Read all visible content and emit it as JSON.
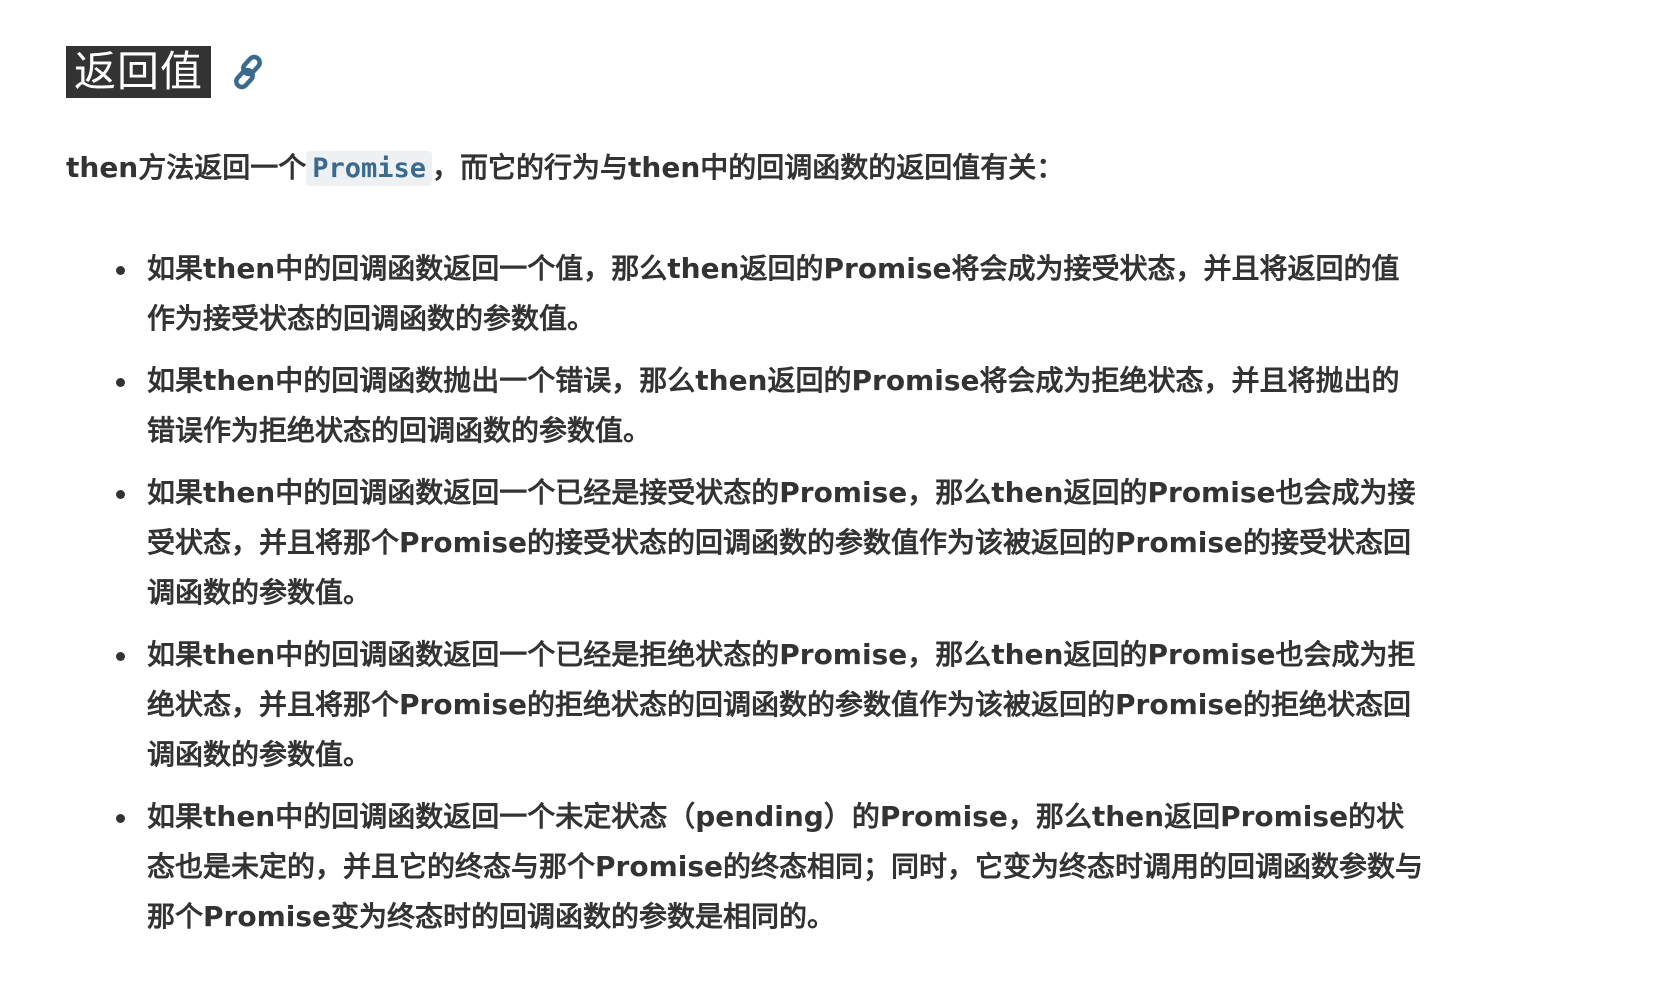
{
  "heading": {
    "title": "返回值",
    "link_icon": "link-icon"
  },
  "intro": {
    "before": "then方法返回一个",
    "code": "Promise",
    "after": "，而它的行为与then中的回调函数的返回值有关："
  },
  "items": [
    "如果then中的回调函数返回一个值，那么then返回的Promise将会成为接受状态，并且将返回的值作为接受状态的回调函数的参数值。",
    "如果then中的回调函数抛出一个错误，那么then返回的Promise将会成为拒绝状态，并且将抛出的错误作为拒绝状态的回调函数的参数值。",
    "如果then中的回调函数返回一个已经是接受状态的Promise，那么then返回的Promise也会成为接受状态，并且将那个Promise的接受状态的回调函数的参数值作为该被返回的Promise的接受状态回调函数的参数值。",
    "如果then中的回调函数返回一个已经是拒绝状态的Promise，那么then返回的Promise也会成为拒绝状态，并且将那个Promise的拒绝状态的回调函数的参数值作为该被返回的Promise的拒绝状态回调函数的参数值。",
    "如果then中的回调函数返回一个未定状态（pending）的Promise，那么then返回Promise的状态也是未定的，并且它的终态与那个Promise的终态相同；同时，它变为终态时调用的回调函数参数与那个Promise变为终态时的回调函数的参数是相同的。"
  ],
  "colors": {
    "text": "#333333",
    "code": "#3b6a8f",
    "link": "#3b6a8f",
    "heading_bg": "#333333"
  }
}
